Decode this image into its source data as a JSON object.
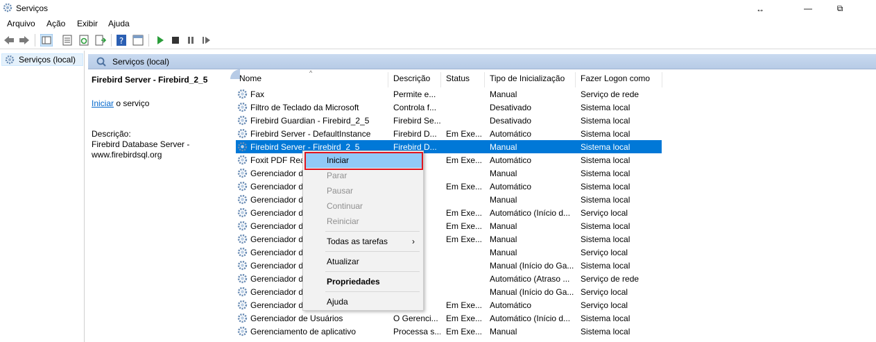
{
  "window": {
    "title": "Serviços",
    "minimize_glyph": "—",
    "maximize_glyph": "⧉",
    "resize_glyph": "↔"
  },
  "menu": [
    "Arquivo",
    "Ação",
    "Exibir",
    "Ajuda"
  ],
  "tree": {
    "item_label": "Serviços (local)"
  },
  "pane": {
    "header_label": "Serviços (local)",
    "selected_service_title": "Firebird Server - Firebird_2_5",
    "start_link": "Iniciar",
    "start_suffix": " o serviço",
    "description_label": "Descrição:",
    "description_text": "Firebird Database Server - www.firebirdsql.org"
  },
  "columns": {
    "name": "Nome",
    "description": "Descrição",
    "status": "Status",
    "startup_type": "Tipo de Inicialização",
    "logon_as": "Fazer Logon como"
  },
  "rows": [
    {
      "name": "Fax",
      "desc": "Permite e...",
      "status": "",
      "type": "Manual",
      "logon": "Serviço de rede"
    },
    {
      "name": "Filtro de Teclado da Microsoft",
      "desc": "Controla f...",
      "status": "",
      "type": "Desativado",
      "logon": "Sistema local"
    },
    {
      "name": "Firebird Guardian - Firebird_2_5",
      "desc": "Firebird Se...",
      "status": "",
      "type": "Desativado",
      "logon": "Sistema local"
    },
    {
      "name": "Firebird Server - DefaultInstance",
      "desc": "Firebird D...",
      "status": "Em Exe...",
      "type": "Automático",
      "logon": "Sistema local"
    },
    {
      "name": "Firebird Server - Firebird_2_5",
      "desc": "Firebird D...",
      "status": "",
      "type": "Manual",
      "logon": "Sistema local",
      "selected": true
    },
    {
      "name": "Foxit PDF Rea",
      "desc": "",
      "status": "Em Exe...",
      "type": "Automático",
      "logon": "Sistema local"
    },
    {
      "name": "Gerenciador d",
      "desc": "",
      "status": "",
      "type": "Manual",
      "logon": "Sistema local"
    },
    {
      "name": "Gerenciador d",
      "desc": "ha c...",
      "status": "Em Exe...",
      "type": "Automático",
      "logon": "Sistema local"
    },
    {
      "name": "Gerenciador d",
      "desc": "",
      "status": "",
      "type": "Manual",
      "logon": "Sistema local"
    },
    {
      "name": "Gerenciador d",
      "desc": "eci...",
      "status": "Em Exe...",
      "type": "Automático (Início d...",
      "logon": "Serviço local"
    },
    {
      "name": "Gerenciador d",
      "desc": "viç...",
      "status": "Em Exe...",
      "type": "Manual",
      "logon": "Sistema local"
    },
    {
      "name": "Gerenciador d",
      "desc": "...",
      "status": "Em Exe...",
      "type": "Manual",
      "logon": "Sistema local"
    },
    {
      "name": "Gerenciador d",
      "desc": "s ...",
      "status": "",
      "type": "Manual",
      "logon": "Serviço local"
    },
    {
      "name": "Gerenciador d",
      "desc": "...",
      "status": "",
      "type": "Manual (Início do Ga...",
      "logon": "Sistema local"
    },
    {
      "name": "Gerenciador d",
      "desc": "Wi...",
      "status": "",
      "type": "Automático (Atraso ...",
      "logon": "Serviço de rede"
    },
    {
      "name": "Gerenciador d",
      "desc": "...",
      "status": "",
      "type": "Manual (Início do Ga...",
      "logon": "Serviço local"
    },
    {
      "name": "Gerenciador d",
      "desc": "...",
      "status": "Em Exe...",
      "type": "Automático",
      "logon": "Serviço local"
    },
    {
      "name": "Gerenciador de Usuários",
      "desc": "O Gerenci...",
      "status": "Em Exe...",
      "type": "Automático (Início d...",
      "logon": "Sistema local"
    },
    {
      "name": "Gerenciamento de aplicativo",
      "desc": "Processa s...",
      "status": "Em Exe...",
      "type": "Manual",
      "logon": "Sistema local"
    }
  ],
  "context_menu": {
    "start": "Iniciar",
    "stop": "Parar",
    "pause": "Pausar",
    "resume": "Continuar",
    "restart": "Reiniciar",
    "all_tasks": "Todas as tarefas",
    "refresh": "Atualizar",
    "properties": "Propriedades",
    "help": "Ajuda",
    "submenu_arrow": "›"
  },
  "colors": {
    "selection": "#0078d7",
    "menu_highlight": "#91c9f7",
    "callout": "#e0141e",
    "link": "#0066cc"
  }
}
